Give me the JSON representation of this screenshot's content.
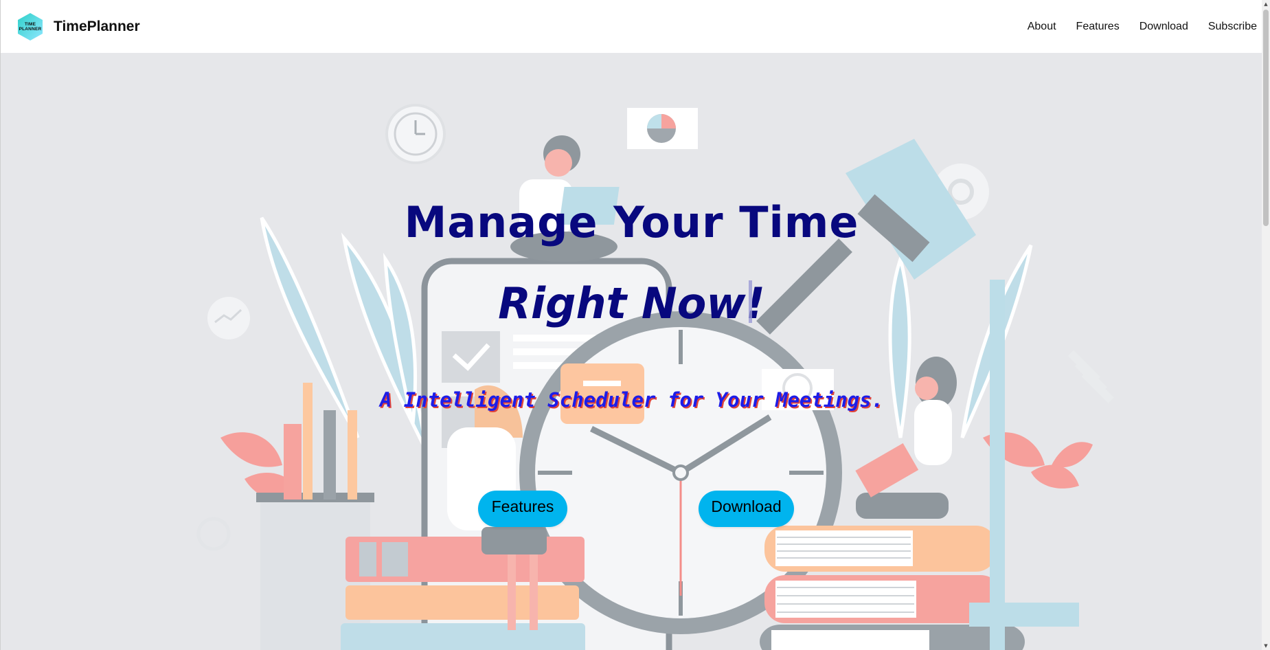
{
  "header": {
    "brand_name": "TimePlanner",
    "logo_line1": "TIME",
    "logo_line2": "PLANNER",
    "nav": [
      "About",
      "Features",
      "Download",
      "Subscribe"
    ]
  },
  "hero": {
    "headline_line1": "Manage Your Time",
    "headline_line2": "Right Now!",
    "tagline": "A Intelligent Scheduler for Your Meetings.",
    "buttons": {
      "features": "Features",
      "download": "Download"
    }
  },
  "colors": {
    "headline": "#08087e",
    "tagline": "#1d1de8",
    "tagline_shadow": "#e0443a",
    "button_bg": "#00b4ee",
    "hero_bg": "#e6e7ea",
    "logo_gradient_start": "#2fd0c9",
    "logo_gradient_end": "#8fe7ff"
  },
  "icons": [
    "logo-hexagon-icon",
    "scroll-up-arrow-icon",
    "scroll-down-arrow-icon"
  ]
}
